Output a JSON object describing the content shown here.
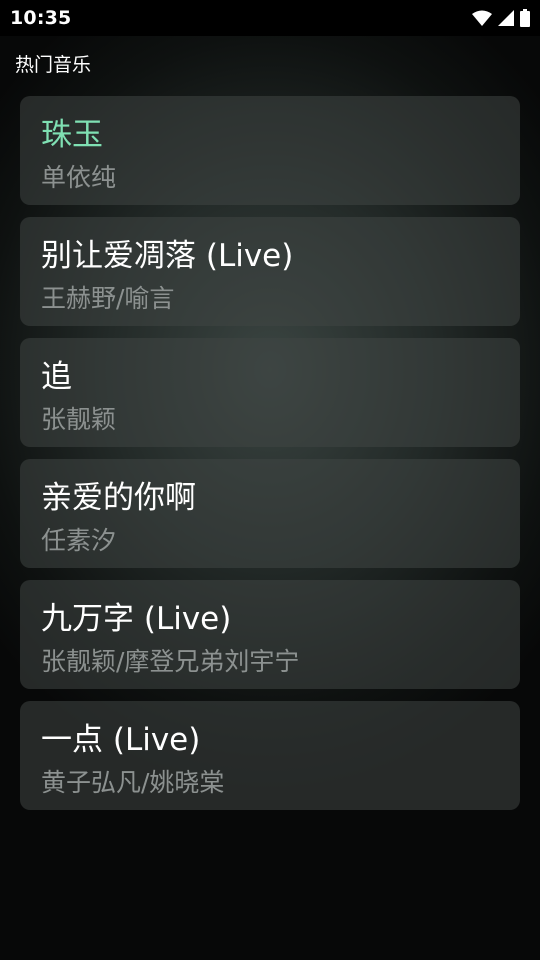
{
  "status_bar": {
    "time": "10:35",
    "icons": [
      "wifi-icon",
      "cell-signal-icon",
      "battery-icon"
    ]
  },
  "header": {
    "title": "热门音乐"
  },
  "colors": {
    "active_title": "#7fe0b3",
    "artist_text": "#8c9190"
  },
  "songs": [
    {
      "title": "珠玉",
      "artist": "单依纯",
      "active": true
    },
    {
      "title": "别让爱凋落 (Live)",
      "artist": "王赫野/喻言",
      "active": false
    },
    {
      "title": "追",
      "artist": "张靓颖",
      "active": false
    },
    {
      "title": "亲爱的你啊",
      "artist": "任素汐",
      "active": false
    },
    {
      "title": "九万字 (Live)",
      "artist": "张靓颖/摩登兄弟刘宇宁",
      "active": false
    },
    {
      "title": "一点 (Live)",
      "artist": "黄子弘凡/姚晓棠",
      "active": false
    }
  ]
}
